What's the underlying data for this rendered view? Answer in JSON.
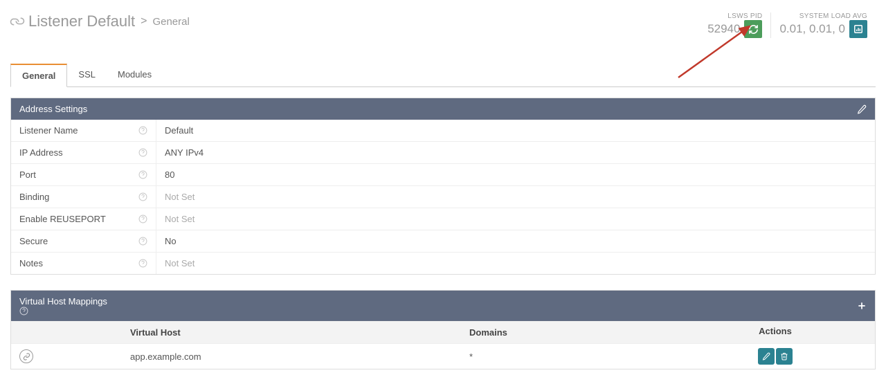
{
  "header": {
    "title_main": "Listener Default",
    "breadcrumb_current": "General",
    "stats": {
      "pid_label": "LSWS PID",
      "pid_value": "52940",
      "load_label": "SYSTEM LOAD AVG",
      "load_value": "0.01, 0.01, 0"
    }
  },
  "tabs": [
    {
      "label": "General",
      "active": true
    },
    {
      "label": "SSL",
      "active": false
    },
    {
      "label": "Modules",
      "active": false
    }
  ],
  "address_panel": {
    "title": "Address Settings",
    "rows": [
      {
        "label": "Listener Name",
        "value": "Default",
        "muted": false
      },
      {
        "label": "IP Address",
        "value": "ANY IPv4",
        "muted": false
      },
      {
        "label": "Port",
        "value": "80",
        "muted": false
      },
      {
        "label": "Binding",
        "value": "Not Set",
        "muted": true
      },
      {
        "label": "Enable REUSEPORT",
        "value": "Not Set",
        "muted": true
      },
      {
        "label": "Secure",
        "value": "No",
        "muted": false
      },
      {
        "label": "Notes",
        "value": "Not Set",
        "muted": true
      }
    ]
  },
  "vhost_panel": {
    "title": "Virtual Host Mappings",
    "columns": {
      "vhost": "Virtual Host",
      "domains": "Domains",
      "actions": "Actions"
    },
    "rows": [
      {
        "vhost": "app.example.com",
        "domains": "*"
      }
    ]
  }
}
